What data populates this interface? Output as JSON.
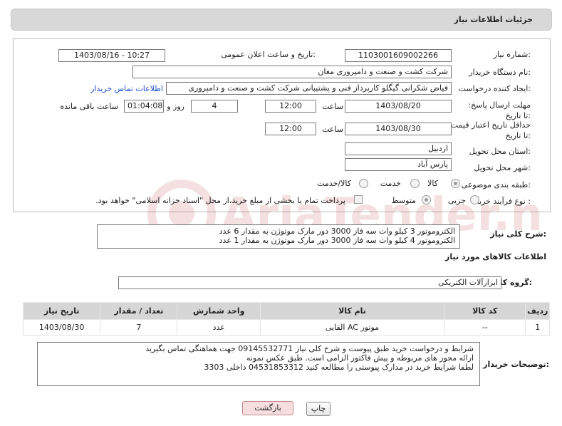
{
  "header": {
    "title": "جزئیات اطلاعات نیاز"
  },
  "form": {
    "need_number_label": "شماره نیاز:",
    "need_number": "1103001609002266",
    "announce_label": "تاریخ و ساعت اعلان عمومی:",
    "announce_value": "1403/08/16 - 10:27",
    "buyer_org_label": "نام دستگاه خریدار:",
    "buyer_org": "شرکت کشت و صنعت و دامپروری مغان",
    "requester_label": "ایجاد کننده درخواست:",
    "requester": "فیاض شکرانی گیگلو کارپرداز فنی و پشتیبانی شرکت کشت و صنعت و دامپروری",
    "contact_link": "اطلاعات تماس خریدار",
    "deadline_label": "مهلت ارسال پاسخ: تا تاریخ:",
    "deadline_date": "1403/08/20",
    "time_label": "ساعت",
    "deadline_time": "12:00",
    "remaining_days": "4",
    "days_and_label": "روز و",
    "remaining_time": "01:04:08",
    "remaining_label": "ساعت باقی مانده",
    "validity_label": "حداقل تاریخ اعتبار قیمت: تا تاریخ:",
    "validity_date": "1403/08/30",
    "validity_time": "12:00",
    "province_label": "استان محل تحویل:",
    "province": "اردبیل",
    "city_label": "شهر محل تحویل:",
    "city": "پارس آباد",
    "category_label": "طبقه بندی موضوعی:",
    "category_options": [
      "کالا",
      "خدمت",
      "کالا/خدمت"
    ],
    "purchase_type_label": "نوع فرآیند خرید :",
    "purchase_options": [
      "جزیی",
      "متوسط"
    ],
    "payment_note": "پرداخت تمام یا بخشی از مبلغ خرید،از محل \"اسناد خزانه اسلامی\" خواهد بود."
  },
  "watermark": {
    "text": "AriaTender.neT"
  },
  "general_desc": {
    "label": "شرح کلی نیاز:",
    "line1": "الکتروموتور 3 کیلو وات سه فاز 3000 دور مارک موتوژن به مقدار 6 عدد",
    "line2": "الکتروموتور 4 کیلو وات سه فاز 3000 دور مارک موتوژن به مقدار 1 عدد"
  },
  "goods_section": {
    "title": "اطلاعات کالاهای مورد نیاز"
  },
  "goods_group": {
    "label": "گروه کالا:",
    "value": "ابزارآلات الکتریکی"
  },
  "table": {
    "headers": [
      "ردیف",
      "کد کالا",
      "نام کالا",
      "واحد شمارش",
      "تعداد / مقدار",
      "تاریخ نیاز"
    ],
    "rows": [
      [
        "1",
        "--",
        "موتور AC القایی",
        "عدد",
        "7",
        "1403/08/30"
      ]
    ]
  },
  "buyer_notes": {
    "label": "توضیحات خریدار:",
    "line1": "شرایط و درخواست خرید طبق پیوست و شرح کلی نیاز 09145532771 جهت هماهنگی تماس بگیرید",
    "line2": "ارائه مجوز های مربوطه و پیش فاکتور الزامی است. طبق عکس نمونه",
    "line3": "لطفا شرایط خرید در مدارک پیوستی را مطالعه کنید        04531853312    داخلی  3303"
  },
  "buttons": {
    "print": "چاپ",
    "back": "بازگشت"
  },
  "colors": {
    "link": "#1a4fd6",
    "header_bg": "#d8d8d8",
    "back_button": "#f6dede"
  }
}
